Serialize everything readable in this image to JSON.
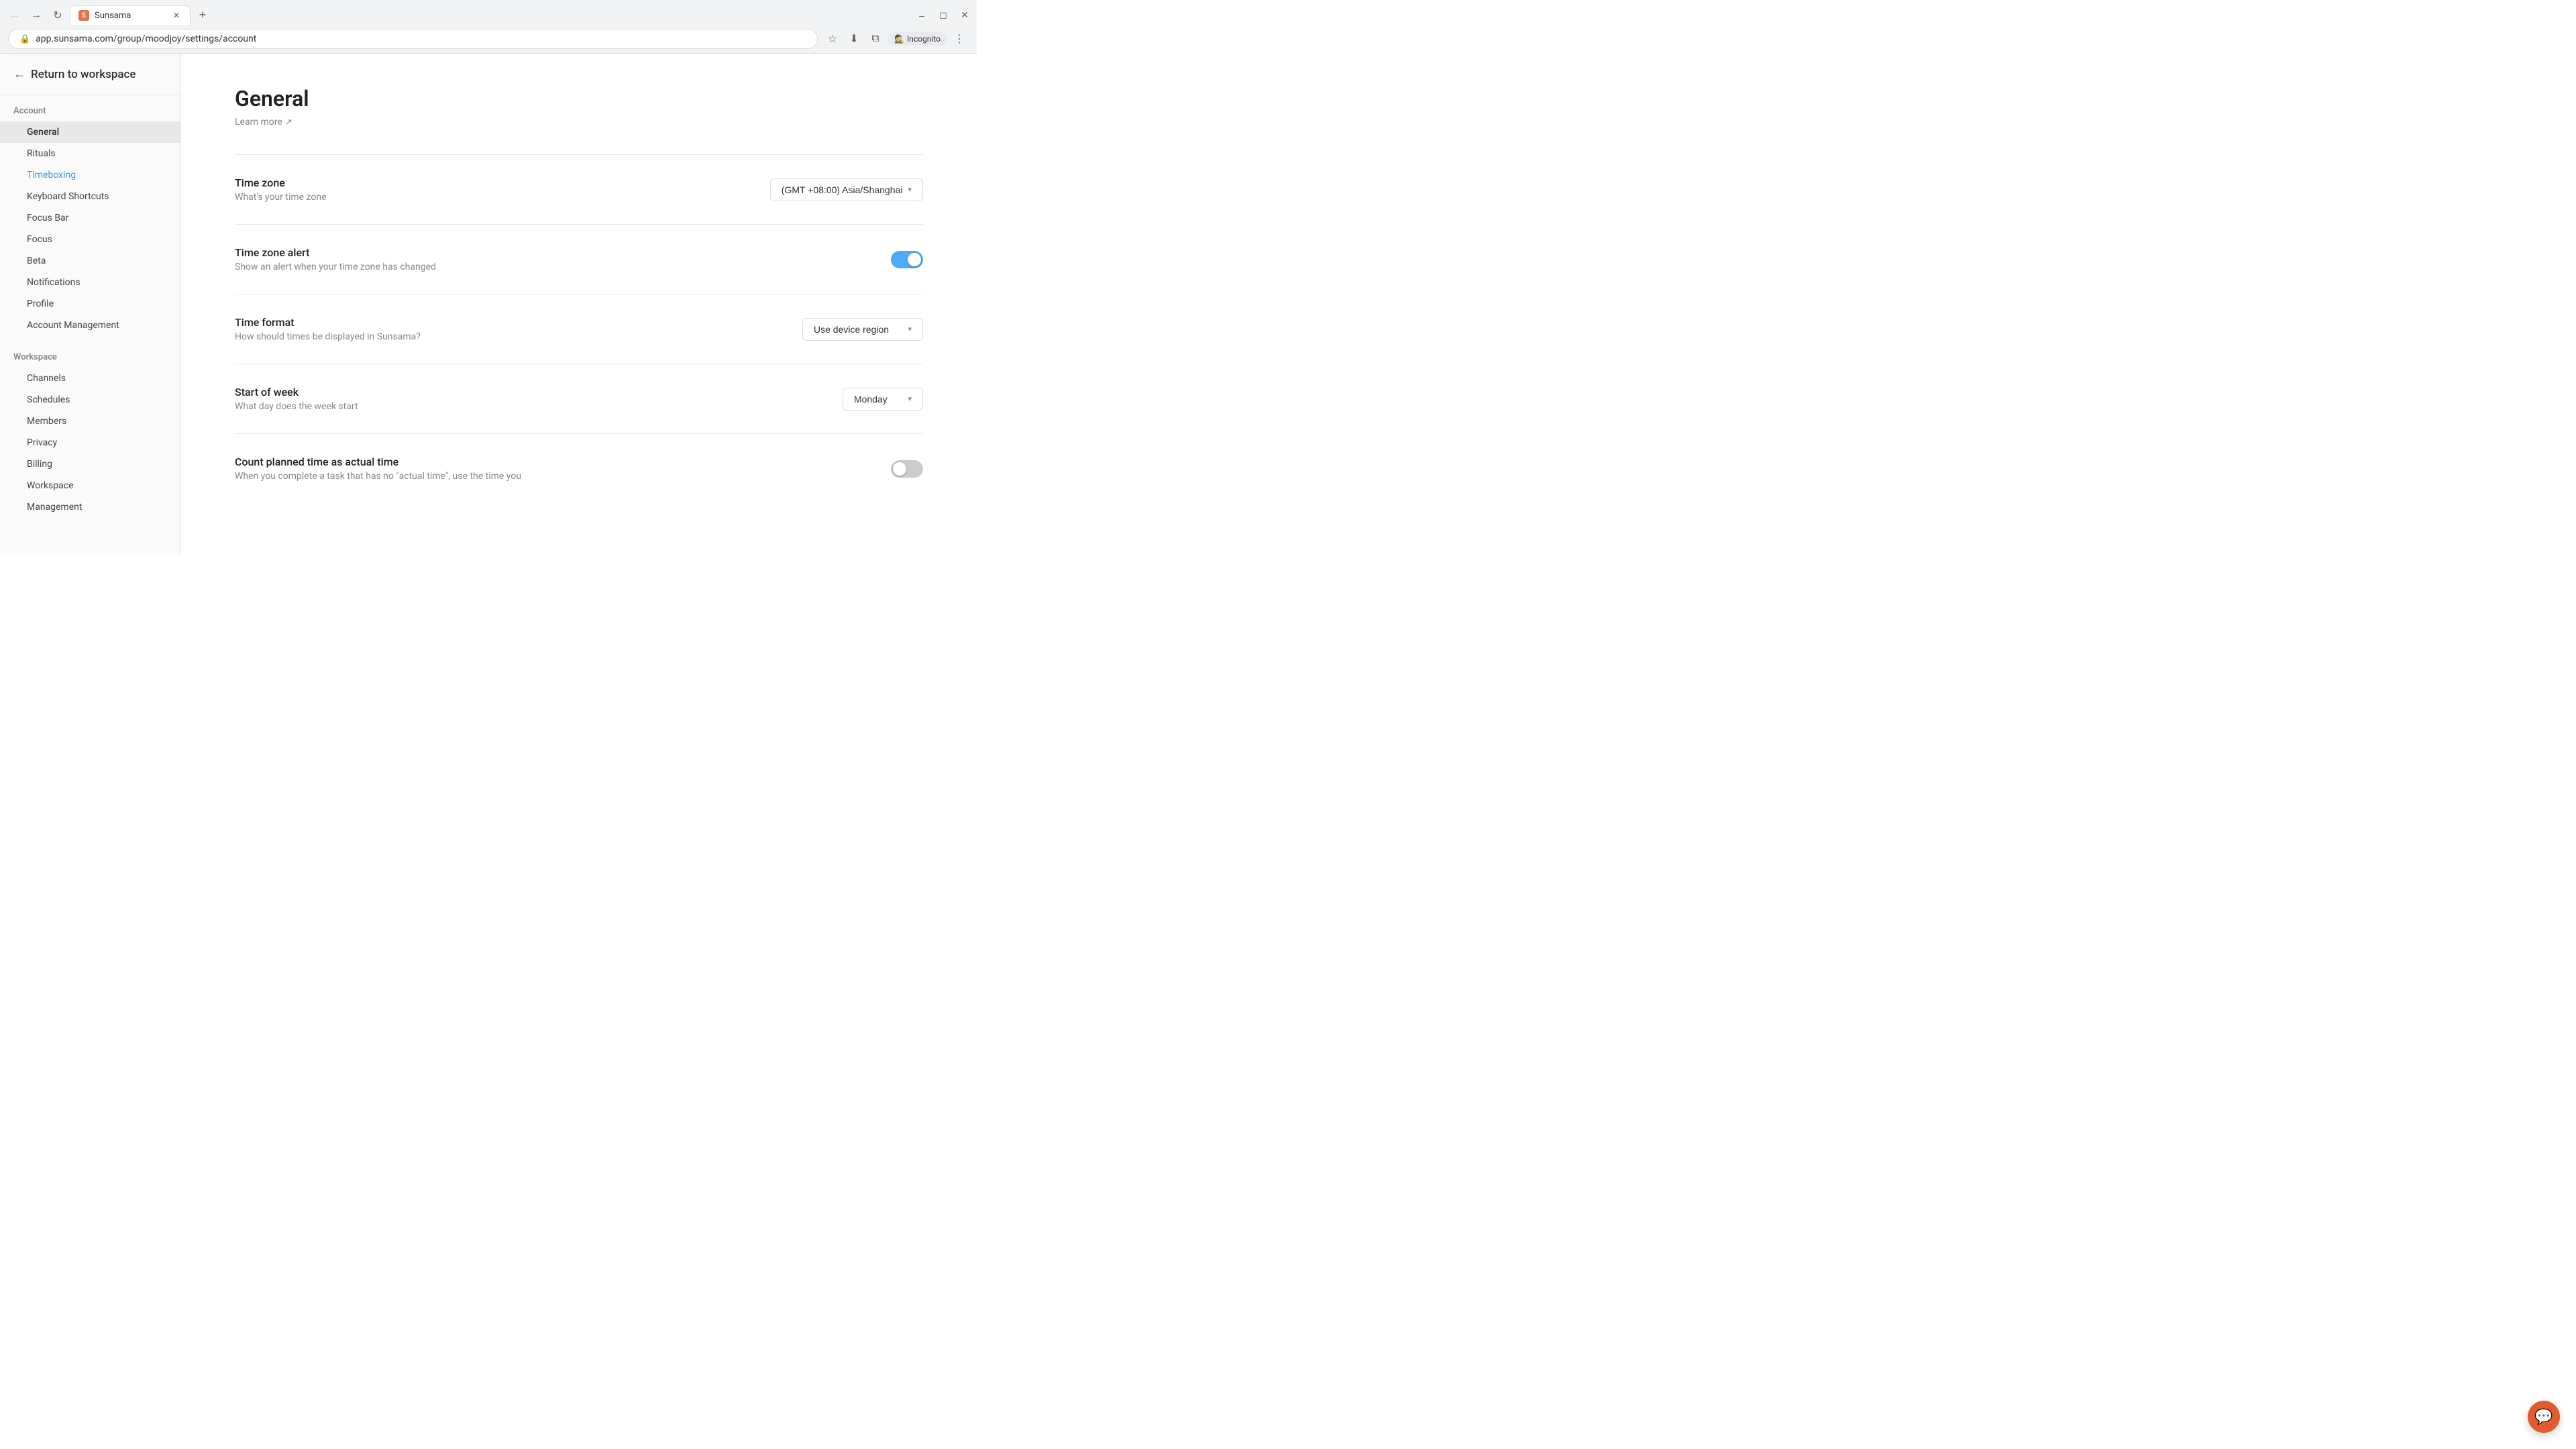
{
  "browser": {
    "tab_title": "Sunsama",
    "tab_favicon": "S",
    "url": "app.sunsama.com/group/moodjoy/settings/account",
    "incognito_label": "Incognito"
  },
  "sidebar": {
    "return_label": "Return to workspace",
    "account_section_label": "Account",
    "account_items": [
      {
        "label": "General",
        "active": true,
        "highlighted": false
      },
      {
        "label": "Rituals",
        "active": false,
        "highlighted": false
      },
      {
        "label": "Timeboxing",
        "active": false,
        "highlighted": true
      },
      {
        "label": "Keyboard Shortcuts",
        "active": false,
        "highlighted": false
      },
      {
        "label": "Focus Bar",
        "active": false,
        "highlighted": false
      },
      {
        "label": "Focus",
        "active": false,
        "highlighted": false
      },
      {
        "label": "Beta",
        "active": false,
        "highlighted": false
      },
      {
        "label": "Notifications",
        "active": false,
        "highlighted": false
      },
      {
        "label": "Profile",
        "active": false,
        "highlighted": false
      },
      {
        "label": "Account Management",
        "active": false,
        "highlighted": false
      }
    ],
    "workspace_section_label": "Workspace",
    "workspace_items": [
      {
        "label": "Channels",
        "active": false
      },
      {
        "label": "Schedules",
        "active": false
      },
      {
        "label": "Members",
        "active": false
      },
      {
        "label": "Privacy",
        "active": false
      },
      {
        "label": "Billing",
        "active": false
      },
      {
        "label": "Workspace",
        "active": false
      },
      {
        "label": "Management",
        "active": false
      }
    ]
  },
  "main": {
    "title": "General",
    "learn_more": "Learn more",
    "sections": [
      {
        "id": "time_zone",
        "label": "Time zone",
        "description": "What's your time zone",
        "control_type": "dropdown",
        "value": "(GMT +08:00) Asia/Shanghai"
      },
      {
        "id": "time_zone_alert",
        "label": "Time zone alert",
        "description": "Show an alert when your time zone has changed",
        "control_type": "toggle",
        "value": true
      },
      {
        "id": "time_format",
        "label": "Time format",
        "description": "How should times be displayed in Sunsama?",
        "control_type": "dropdown",
        "value": "Use device region"
      },
      {
        "id": "start_of_week",
        "label": "Start of week",
        "description": "What day does the week start",
        "control_type": "dropdown",
        "value": "Monday"
      },
      {
        "id": "count_planned_time",
        "label": "Count planned time as actual time",
        "description": "When you complete a task that has no \"actual time\", use the time you",
        "control_type": "toggle",
        "value": false
      }
    ]
  },
  "chat_button_label": "💬"
}
